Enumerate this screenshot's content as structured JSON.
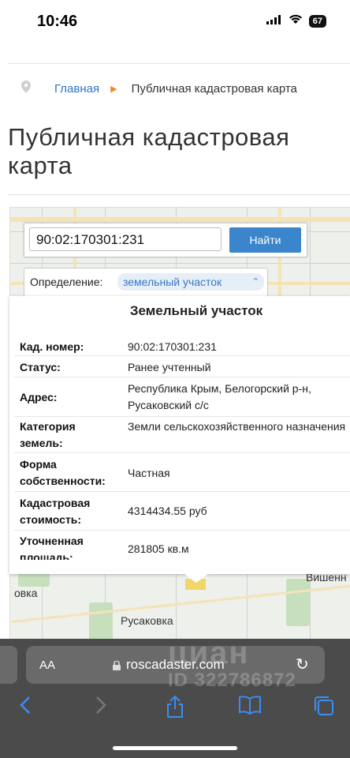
{
  "status_bar": {
    "time": "10:46",
    "battery": "67"
  },
  "breadcrumb": {
    "home": "Главная",
    "separator": "▶",
    "current": "Публичная кадастровая карта"
  },
  "page": {
    "title": "Публичная кадастровая карта"
  },
  "search": {
    "value": "90:02:170301:231",
    "button": "Найти"
  },
  "definition": {
    "label": "Определение:",
    "selected": "земельный участок"
  },
  "card": {
    "title": "Земельный участок",
    "rows": [
      {
        "key": "Кад. номер:",
        "value": "90:02:170301:231"
      },
      {
        "key": "Статус:",
        "value": "Ранее учтенный"
      },
      {
        "key": "Адрес:",
        "value": "Республика Крым, Белогорский р-н, Русаковский с/с"
      },
      {
        "key": "Категория земель:",
        "value": "Земли сельскохозяйственного назначения"
      },
      {
        "key": "Форма собственности:",
        "value": "Частная"
      },
      {
        "key": "Кадастровая стоимость:",
        "value": "4314434.55 руб"
      },
      {
        "key": "Уточненная площадь:",
        "value": "281805 кв.м"
      }
    ]
  },
  "map": {
    "labels": [
      "овка",
      "Русаковка",
      "Вишенн"
    ]
  },
  "browser": {
    "aa": "AA",
    "url": "roscadaster.com"
  },
  "watermark": {
    "brand": "циан",
    "id": "ID 322786872"
  }
}
